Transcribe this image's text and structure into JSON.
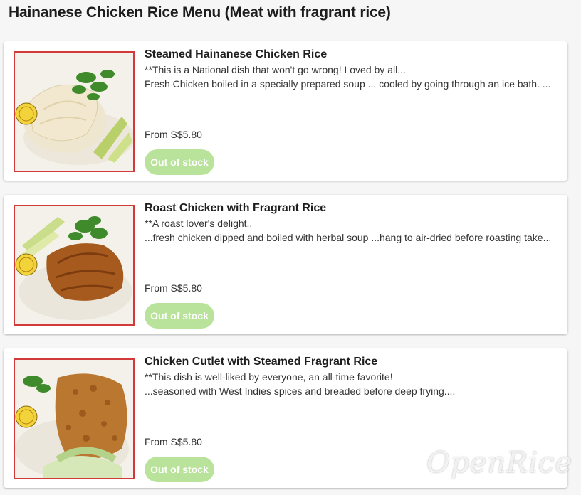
{
  "page": {
    "title": "Hainanese Chicken Rice Menu (Meat with fragrant rice)"
  },
  "items": [
    {
      "name": "Steamed Hainanese Chicken Rice",
      "line1": "**This is a National dish that won't go wrong! Loved by all...",
      "line2": "Fresh Chicken boiled in a specially prepared soup ... cooled by going through an ice bath. ...",
      "price": "From S$5.80",
      "stock_label": "Out of stock"
    },
    {
      "name": "Roast Chicken with Fragrant Rice",
      "line1": "**A roast lover's delight..",
      "line2": "...fresh chicken dipped and boiled with herbal soup ...hang to air-dried before roasting take...",
      "price": "From S$5.80",
      "stock_label": "Out of stock"
    },
    {
      "name": "Chicken Cutlet with Steamed Fragrant Rice",
      "line1": "**This dish is well-liked by everyone, an all-time favorite!",
      "line2": "...seasoned with West Indies spices and breaded before deep frying....",
      "price": "From S$5.80",
      "stock_label": "Out of stock"
    }
  ],
  "watermark": "OpenRice",
  "colors": {
    "button_bg": "#b9e39a",
    "thumb_border": "#d23a3a"
  }
}
